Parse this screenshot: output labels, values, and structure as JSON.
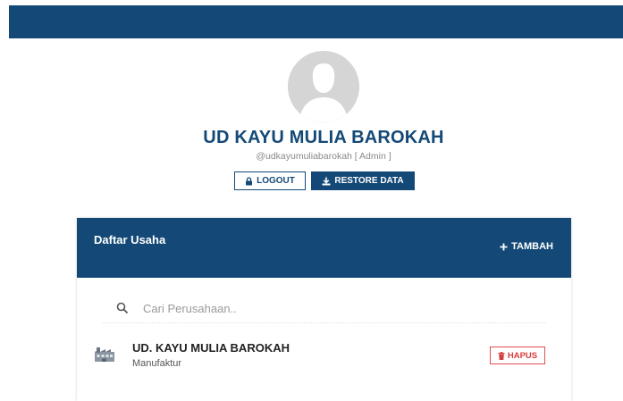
{
  "profile": {
    "company_name": "UD KAYU MULIA BAROKAH",
    "username": "@udkayumuliabarokah [ Admin ]"
  },
  "actions": {
    "logout_label": "LOGOUT",
    "restore_label": "RESTORE DATA"
  },
  "business_list": {
    "title": "Daftar Usaha",
    "add_label": "TAMBAH",
    "search": {
      "placeholder": "Cari Perusahaan..",
      "value": ""
    },
    "items": [
      {
        "name": "UD. KAYU MULIA BAROKAH",
        "type": "Manufaktur",
        "delete_label": "HAPUS"
      }
    ]
  },
  "colors": {
    "primary": "#144977",
    "danger": "#d83c3c",
    "avatar_bg": "#d5d5d5"
  },
  "icons": [
    "user-avatar-icon",
    "lock-icon",
    "download-icon",
    "plus-icon",
    "search-icon",
    "factory-icon",
    "trash-icon"
  ]
}
